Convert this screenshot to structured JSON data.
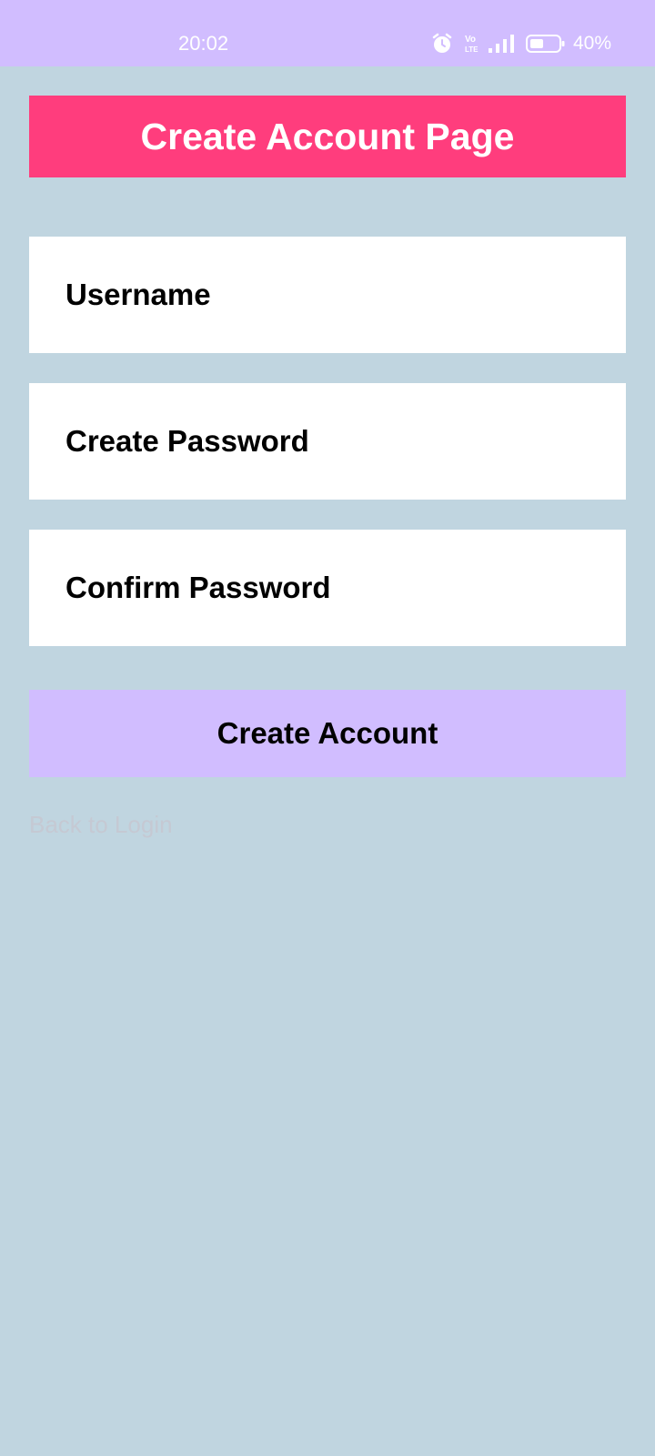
{
  "status_bar": {
    "time": "20:02",
    "battery_percent": "40%",
    "network_label": "Vo LTE",
    "icons": [
      "alarm-icon",
      "volte-icon",
      "signal-icon",
      "battery-icon"
    ]
  },
  "header": {
    "title": "Create Account Page",
    "color": "#ff3d7d"
  },
  "form": {
    "username_placeholder": "Username",
    "create_password_placeholder": "Create Password",
    "confirm_password_placeholder": "Confirm Password"
  },
  "actions": {
    "create_account_label": "Create Account",
    "back_to_login_label": "Back to Login"
  },
  "colors": {
    "background": "#c0d5e0",
    "accent": "#d1bdff",
    "header": "#ff3d7d"
  }
}
